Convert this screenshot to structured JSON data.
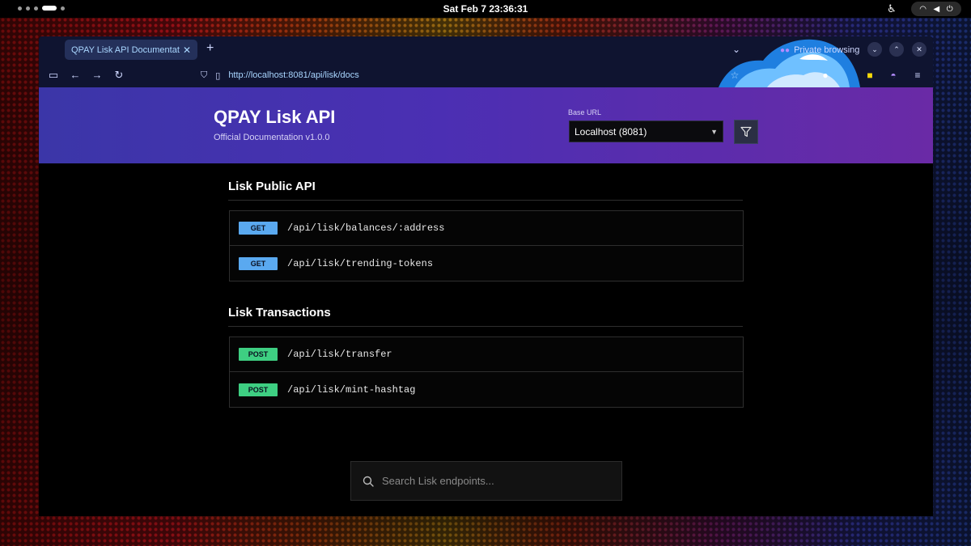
{
  "system": {
    "clock": "Sat Feb 7  23:36:31"
  },
  "browser": {
    "tab_title": "QPAY Lisk API Documentation",
    "url": "http://localhost:8081/api/lisk/docs",
    "private_label": "Private browsing",
    "icons": [
      "sidebar-icon",
      "back-icon",
      "forward-icon",
      "reload-icon",
      "shield-icon",
      "page-icon",
      "star-icon",
      "extension-icon"
    ]
  },
  "header": {
    "title": "QPAY Lisk API",
    "subtitle": "Official Documentation v1.0.0",
    "base_url_label": "Base URL",
    "base_url_value": "Localhost (8081)"
  },
  "sections": [
    {
      "title": "Lisk Public API",
      "endpoints": [
        {
          "method": "GET",
          "path": "/api/lisk/balances/:address"
        },
        {
          "method": "GET",
          "path": "/api/lisk/trending-tokens"
        }
      ]
    },
    {
      "title": "Lisk Transactions",
      "endpoints": [
        {
          "method": "POST",
          "path": "/api/lisk/transfer"
        },
        {
          "method": "POST",
          "path": "/api/lisk/mint-hashtag"
        }
      ]
    }
  ],
  "search": {
    "placeholder": "Search Lisk endpoints..."
  },
  "colors": {
    "get": "#5aa9f0",
    "post": "#3ecf82",
    "banner_start": "#3b36a8",
    "banner_end": "#6a2aa6"
  }
}
